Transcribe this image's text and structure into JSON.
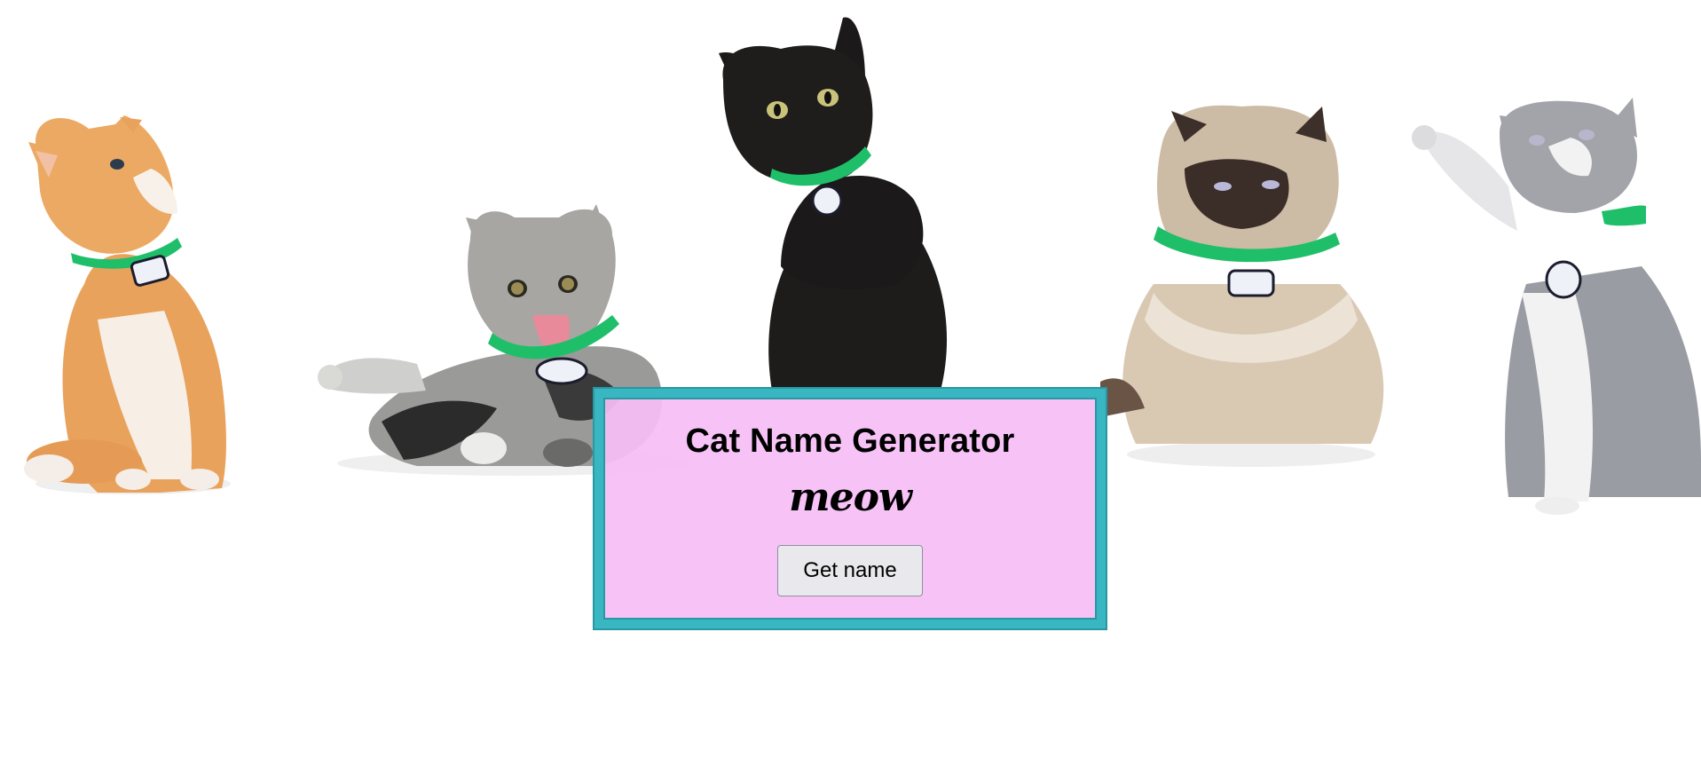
{
  "app": {
    "title": "Cat Name Generator",
    "subtitle": "meow",
    "button_label": "Get name"
  },
  "colors": {
    "background": "#ffffff",
    "card_background": "#f6bef6",
    "card_border": "#38b7c2",
    "collar": "#1fbf6a",
    "button_background": "#e9e9ed"
  },
  "images": [
    {
      "name": "orange-kitten-image",
      "description": "orange kitten with green collar looking up"
    },
    {
      "name": "tabby-kitten-image",
      "description": "silver tabby kitten lying down with green collar"
    },
    {
      "name": "black-cat-image",
      "description": "black cat sitting with green collar"
    },
    {
      "name": "persian-cat-image",
      "description": "fluffy himalayan cat with green collar"
    },
    {
      "name": "grey-kitten-image",
      "description": "grey and white kitten pawing up with green collar"
    }
  ]
}
